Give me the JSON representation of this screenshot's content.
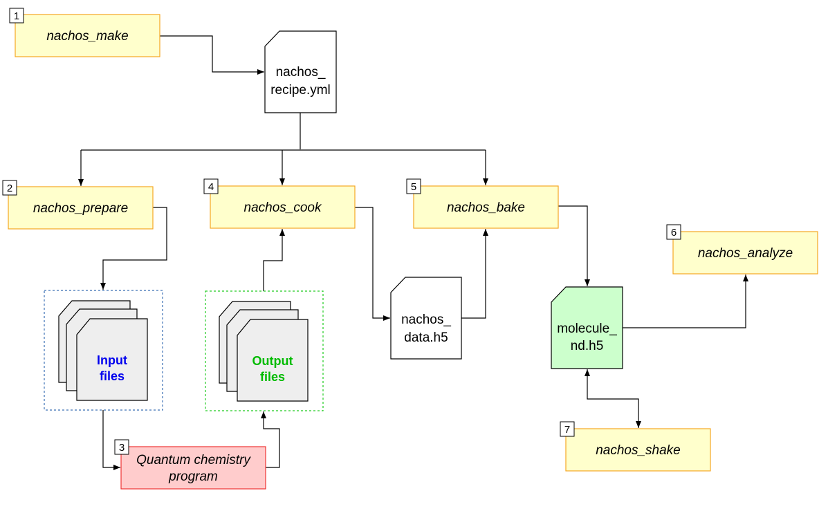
{
  "processes": [
    {
      "step": "1",
      "label": "nachos_make"
    },
    {
      "step": "2",
      "label": "nachos_prepare"
    },
    {
      "step": "3",
      "label_lines": [
        "Quantum chemistry",
        "program"
      ]
    },
    {
      "step": "4",
      "label": "nachos_cook"
    },
    {
      "step": "5",
      "label": "nachos_bake"
    },
    {
      "step": "6",
      "label": "nachos_analyze"
    },
    {
      "step": "7",
      "label": "nachos_shake"
    }
  ],
  "files": {
    "recipe": [
      "nachos_",
      "recipe.yml"
    ],
    "data": [
      "nachos_",
      "data.h5"
    ],
    "molecule": [
      "molecule_",
      "nd.h5"
    ],
    "input": [
      "Input",
      "files"
    ],
    "output": [
      "Output",
      "files"
    ]
  },
  "colors": {
    "process_fill": "#ffffcc",
    "process_border": "#f5a623",
    "program_fill": "#ffcccc",
    "program_border": "#ee3333",
    "input_text": "#0000ee",
    "output_text": "#00bb00",
    "molecule_fill": "#ccffcc",
    "input_group_border": "#3a6fb5",
    "output_group_border": "#22cc22"
  }
}
